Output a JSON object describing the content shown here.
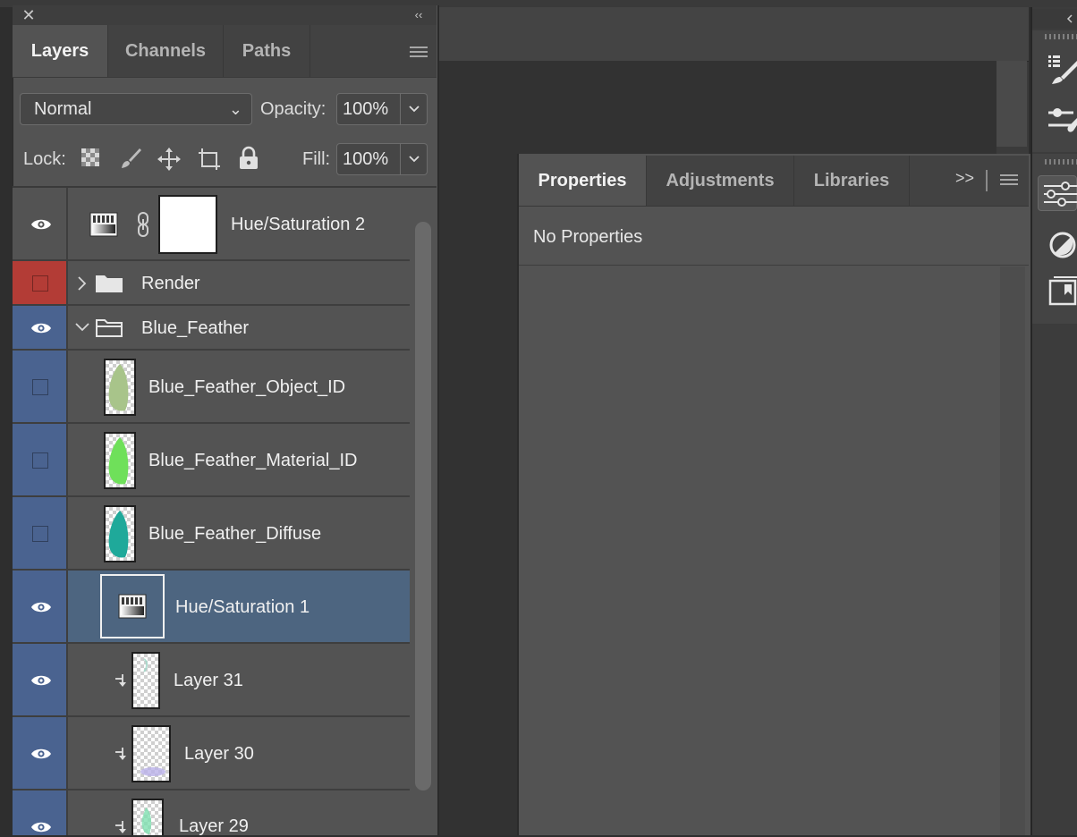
{
  "layers_panel": {
    "tabs": [
      "Layers",
      "Channels",
      "Paths"
    ],
    "active_tab": "Layers",
    "blend_mode": "Normal",
    "opacity_label": "Opacity:",
    "opacity_value": "100%",
    "lock_label": "Lock:",
    "fill_label": "Fill:",
    "fill_value": "100%",
    "close_icon": "close-icon",
    "collapse_icon": "collapse-double-chevron-icon",
    "menu_icon": "panel-menu-icon",
    "layers": [
      {
        "name": "Hue/Saturation 2",
        "type": "adjustment",
        "visible": true,
        "label_color": "none"
      },
      {
        "name": "Render",
        "type": "group",
        "expanded": false,
        "visible": false,
        "label_color": "red"
      },
      {
        "name": "Blue_Feather",
        "type": "group",
        "expanded": true,
        "visible": true,
        "label_color": "blue"
      },
      {
        "name": "Blue_Feather_Object_ID",
        "type": "pixel",
        "visible": false,
        "label_color": "blue"
      },
      {
        "name": "Blue_Feather_Material_ID",
        "type": "pixel",
        "visible": false,
        "label_color": "blue"
      },
      {
        "name": "Blue_Feather_Diffuse",
        "type": "pixel",
        "visible": false,
        "label_color": "blue"
      },
      {
        "name": "Hue/Saturation 1",
        "type": "adjustment",
        "visible": true,
        "selected": true,
        "label_color": "blue"
      },
      {
        "name": "Layer 31",
        "type": "pixel",
        "clipped": true,
        "visible": true,
        "label_color": "blue"
      },
      {
        "name": "Layer 30",
        "type": "pixel",
        "clipped": true,
        "visible": true,
        "label_color": "blue"
      },
      {
        "name": "Layer 29",
        "type": "pixel",
        "clipped": true,
        "visible": true,
        "label_color": "blue"
      }
    ]
  },
  "properties_panel": {
    "tabs": [
      "Properties",
      "Adjustments",
      "Libraries"
    ],
    "active_tab": "Properties",
    "overflow_label": ">>",
    "content": "No Properties"
  },
  "colors": {
    "label_blue": "#4a6390",
    "label_red": "#b33c36",
    "selected_row": "#4d6580",
    "panel_bg": "#535353"
  }
}
